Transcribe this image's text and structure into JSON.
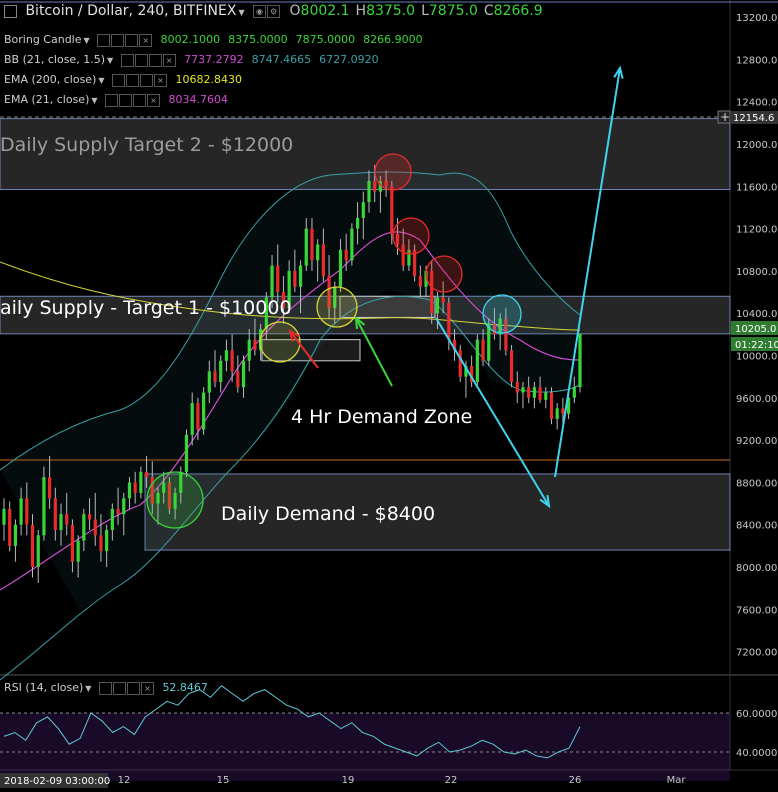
{
  "header": {
    "symbol_title": "Bitcoin / Dollar, 240, BITFINEX",
    "ohlc": [
      {
        "k": "O",
        "v": "8002.1"
      },
      {
        "k": "H",
        "v": "8375.0"
      },
      {
        "k": "L",
        "v": "7875.0"
      },
      {
        "k": "C",
        "v": "8266.9"
      }
    ]
  },
  "indicators": [
    {
      "label": "Boring Candle",
      "values": [
        "8002.1000",
        "8375.0000",
        "7875.0000",
        "8266.9000"
      ],
      "color": "#39d639"
    },
    {
      "label": "BB (21, close, 1.5)",
      "values": [
        "7737.2792",
        "8747.4665",
        "6727.0920"
      ],
      "colors": [
        "#d24cd2",
        "#3aa0a8",
        "#3aa0a8"
      ]
    },
    {
      "label": "EMA (200, close)",
      "values": [
        "10682.8430"
      ],
      "color": "#e6e61e"
    },
    {
      "label": "EMA (21, close)",
      "values": [
        "8034.7604"
      ],
      "color": "#d24cd2"
    }
  ],
  "rsi": {
    "label": "RSI (14, close)",
    "value": "52.8467",
    "color": "#5fc8d8",
    "levels": [
      "60.0000",
      "40.0000"
    ]
  },
  "price_axis": {
    "ticks": [
      "13200.00",
      "12800.00",
      "12400.00",
      "12000.00",
      "11600.00",
      "11200.00",
      "10800.00",
      "10400.00",
      "10000.00",
      "9600.00",
      "9200.00",
      "8800.00",
      "8400.00",
      "8000.00",
      "7600.00",
      "7200.00"
    ],
    "crosshair_label": "12154.6",
    "last_price": "10205.0",
    "countdown": "01:22:10"
  },
  "time_axis": {
    "labels": [
      "12",
      "15",
      "19",
      "22",
      "26",
      "Mar"
    ],
    "cursor_label": "2018-02-09 03:00:00"
  },
  "annotations": {
    "zone_supply2": "Daily Supply Target 2 - $12000",
    "zone_supply1": "aily Supply - Target 1 - $10000",
    "zone_demand": "Daily Demand - $8400",
    "demand_4h": "4 Hr Demand Zone"
  },
  "colors": {
    "up": "#39d639",
    "down": "#e82b2b",
    "zone_fill": "#3a3a3a",
    "zone_border": "#6f86b8",
    "arrow": "#3fd4ee",
    "red_arrow": "#e82b2b",
    "green_arrow": "#39d639",
    "ema200": "#d6d63a",
    "ema21": "#d24cd2",
    "bb": "#3aa0a8"
  },
  "chart_data": {
    "type": "candlestick",
    "title": "Bitcoin / Dollar, 240, BITFINEX",
    "ylim": [
      7000,
      13300
    ],
    "candles": [
      [
        8400,
        8650,
        8250,
        8550
      ],
      [
        8550,
        8620,
        8150,
        8200
      ],
      [
        8200,
        8450,
        8050,
        8400
      ],
      [
        8400,
        8750,
        8300,
        8650
      ],
      [
        8650,
        8800,
        8300,
        8400
      ],
      [
        8400,
        8500,
        7900,
        8000
      ],
      [
        8000,
        8350,
        7850,
        8300
      ],
      [
        8300,
        8950,
        8250,
        8850
      ],
      [
        8850,
        9050,
        8550,
        8650
      ],
      [
        8650,
        8750,
        8250,
        8350
      ],
      [
        8350,
        8600,
        8200,
        8500
      ],
      [
        8500,
        8700,
        8300,
        8400
      ],
      [
        8400,
        8450,
        7950,
        8050
      ],
      [
        8050,
        8300,
        7900,
        8250
      ],
      [
        8250,
        8550,
        8150,
        8500
      ],
      [
        8500,
        8650,
        8350,
        8450
      ],
      [
        8450,
        8700,
        8200,
        8300
      ],
      [
        8300,
        8500,
        8050,
        8150
      ],
      [
        8150,
        8400,
        8000,
        8350
      ],
      [
        8350,
        8600,
        8250,
        8550
      ],
      [
        8550,
        8750,
        8400,
        8500
      ],
      [
        8500,
        8700,
        8300,
        8650
      ],
      [
        8650,
        8850,
        8550,
        8800
      ],
      [
        8800,
        8900,
        8600,
        8700
      ],
      [
        8700,
        8950,
        8650,
        8900
      ],
      [
        8900,
        9050,
        8750,
        8850
      ],
      [
        8850,
        9000,
        8500,
        8600
      ],
      [
        8600,
        8750,
        8400,
        8700
      ],
      [
        8700,
        8900,
        8600,
        8800
      ],
      [
        8800,
        8850,
        8500,
        8550
      ],
      [
        8550,
        8750,
        8450,
        8700
      ],
      [
        8700,
        8950,
        8600,
        8900
      ],
      [
        8900,
        9300,
        8850,
        9250
      ],
      [
        9250,
        9650,
        9150,
        9550
      ],
      [
        9550,
        9600,
        9200,
        9300
      ],
      [
        9300,
        9700,
        9250,
        9650
      ],
      [
        9650,
        9950,
        9550,
        9850
      ],
      [
        9850,
        10050,
        9700,
        9750
      ],
      [
        9750,
        10000,
        9650,
        9950
      ],
      [
        9950,
        10150,
        9850,
        10050
      ],
      [
        10050,
        10200,
        9750,
        9850
      ],
      [
        9850,
        10000,
        9650,
        9700
      ],
      [
        9700,
        10000,
        9600,
        9950
      ],
      [
        9950,
        10250,
        9850,
        10150
      ],
      [
        10150,
        10350,
        10000,
        10050
      ],
      [
        10050,
        10300,
        9950,
        10250
      ],
      [
        10250,
        10600,
        10150,
        10550
      ],
      [
        10550,
        10950,
        10450,
        10850
      ],
      [
        10850,
        11050,
        10500,
        10600
      ],
      [
        10600,
        10750,
        10300,
        10450
      ],
      [
        10450,
        10900,
        10400,
        10800
      ],
      [
        10800,
        11000,
        10600,
        10650
      ],
      [
        10650,
        10900,
        10400,
        10850
      ],
      [
        10850,
        11300,
        10800,
        11200
      ],
      [
        11200,
        11300,
        10800,
        10900
      ],
      [
        10900,
        11100,
        10700,
        11050
      ],
      [
        11050,
        11200,
        10700,
        10750
      ],
      [
        10750,
        10950,
        10350,
        10450
      ],
      [
        10450,
        10700,
        10300,
        10650
      ],
      [
        10650,
        11100,
        10600,
        11000
      ],
      [
        11000,
        11150,
        10800,
        10900
      ],
      [
        10900,
        11250,
        10850,
        11200
      ],
      [
        11200,
        11450,
        11050,
        11300
      ],
      [
        11300,
        11550,
        11100,
        11450
      ],
      [
        11450,
        11750,
        11350,
        11650
      ],
      [
        11650,
        11800,
        11450,
        11550
      ],
      [
        11550,
        11700,
        11350,
        11650
      ],
      [
        11650,
        11750,
        11500,
        11600
      ],
      [
        11600,
        11650,
        11050,
        11150
      ],
      [
        11150,
        11300,
        10950,
        11050
      ],
      [
        11050,
        11200,
        10800,
        10850
      ],
      [
        10850,
        11100,
        10800,
        11000
      ],
      [
        11000,
        11050,
        10700,
        10750
      ],
      [
        10750,
        10850,
        10550,
        10650
      ],
      [
        10650,
        10850,
        10550,
        10800
      ],
      [
        10800,
        10900,
        10300,
        10400
      ],
      [
        10400,
        10600,
        10250,
        10550
      ],
      [
        10550,
        10700,
        10400,
        10500
      ],
      [
        10500,
        10550,
        10050,
        10150
      ],
      [
        10150,
        10250,
        9950,
        10050
      ],
      [
        10050,
        10100,
        9750,
        9800
      ],
      [
        9800,
        9950,
        9600,
        9900
      ],
      [
        9900,
        10000,
        9700,
        9750
      ],
      [
        9750,
        10200,
        9700,
        10150
      ],
      [
        10150,
        10250,
        9900,
        9950
      ],
      [
        9950,
        10350,
        9900,
        10300
      ],
      [
        10300,
        10450,
        10150,
        10200
      ],
      [
        10200,
        10400,
        10050,
        10350
      ],
      [
        10350,
        10450,
        10000,
        10050
      ],
      [
        10050,
        10100,
        9700,
        9750
      ],
      [
        9750,
        9850,
        9550,
        9650
      ],
      [
        9650,
        9750,
        9500,
        9700
      ],
      [
        9700,
        9800,
        9550,
        9600
      ],
      [
        9600,
        9750,
        9500,
        9700
      ],
      [
        9700,
        9800,
        9550,
        9580
      ],
      [
        9580,
        9700,
        9500,
        9650
      ],
      [
        9650,
        9700,
        9350,
        9400
      ],
      [
        9400,
        9550,
        9300,
        9500
      ],
      [
        9500,
        9600,
        9350,
        9450
      ],
      [
        9450,
        9650,
        9400,
        9600
      ],
      [
        9600,
        9800,
        9550,
        9700
      ],
      [
        9700,
        10205,
        9650,
        10205
      ]
    ],
    "zones": [
      {
        "name": "Daily Supply Target 2",
        "low": 11570,
        "high": 12240
      },
      {
        "name": "Daily Supply Target 1",
        "low": 10205,
        "high": 10560
      },
      {
        "name": "Daily Demand",
        "low": 8160,
        "high": 8880
      },
      {
        "name": "4 Hr Demand Zone",
        "low": 9950,
        "high": 10150
      }
    ]
  }
}
